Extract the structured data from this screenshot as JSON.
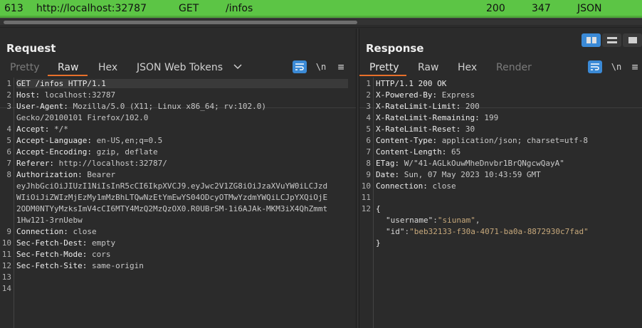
{
  "history": {
    "number": "613",
    "host": "http://localhost:32787",
    "method": "GET",
    "url": "/infos",
    "status": "200",
    "length": "347",
    "mime": "JSON"
  },
  "request": {
    "title": "Request",
    "tabs": [
      "Pretty",
      "Raw",
      "Hex",
      "JSON Web Tokens"
    ],
    "active_tab": "Raw",
    "line_numbers": [
      "1",
      "2",
      "3",
      "",
      "4",
      "5",
      "6",
      "7",
      "8",
      "",
      "",
      "",
      "",
      "9",
      "10",
      "11",
      "12",
      "13",
      "14"
    ],
    "lines": [
      {
        "k": "GET /infos HTTP/1.1",
        "v": ""
      },
      {
        "k": "Host:",
        "v": " localhost:32787"
      },
      {
        "k": "User-Agent:",
        "v": " Mozilla/5.0 (X11; Linux x86_64; rv:102.0)"
      },
      {
        "k": "",
        "v": "Gecko/20100101 Firefox/102.0"
      },
      {
        "k": "Accept:",
        "v": " */*"
      },
      {
        "k": "Accept-Language:",
        "v": " en-US,en;q=0.5"
      },
      {
        "k": "Accept-Encoding:",
        "v": " gzip, deflate"
      },
      {
        "k": "Referer:",
        "v": " http://localhost:32787/"
      },
      {
        "k": "Authorization:",
        "v": " Bearer"
      },
      {
        "k": "",
        "v": "eyJhbGciOiJIUzI1NiIsInR5cCI6IkpXVCJ9.eyJwc2V1ZG8iOiJzaXVuYW0iLCJzd"
      },
      {
        "k": "",
        "v": "WIiOiJiZWIzMjEzMy1mMzBhLTQwNzEtYmEwYS04ODcyOTMwYzdmYWQiLCJpYXQiOjE"
      },
      {
        "k": "",
        "v": "2ODM0NTYyMzksImV4cCI6MTY4MzQ2MzQzOX0.R0UBrSM-1i6AJAk-MKM3iX4QhZmmt"
      },
      {
        "k": "",
        "v": "1Hw121-3rnUebw"
      },
      {
        "k": "Connection:",
        "v": " close"
      },
      {
        "k": "Sec-Fetch-Dest:",
        "v": " empty"
      },
      {
        "k": "Sec-Fetch-Mode:",
        "v": " cors"
      },
      {
        "k": "Sec-Fetch-Site:",
        "v": " same-origin"
      },
      {
        "k": "",
        "v": ""
      },
      {
        "k": "",
        "v": ""
      }
    ]
  },
  "response": {
    "title": "Response",
    "tabs": [
      "Pretty",
      "Raw",
      "Hex",
      "Render"
    ],
    "active_tab": "Pretty",
    "line_numbers": [
      "1",
      "2",
      "3",
      "4",
      "5",
      "6",
      "7",
      "8",
      "9",
      "10",
      "11",
      "12",
      "",
      "",
      ""
    ],
    "lines": [
      {
        "k": "HTTP/1.1 200 OK",
        "v": ""
      },
      {
        "k": "X-Powered-By:",
        "v": " Express"
      },
      {
        "k": "X-RateLimit-Limit:",
        "v": " 200"
      },
      {
        "k": "X-RateLimit-Remaining:",
        "v": " 199"
      },
      {
        "k": "X-RateLimit-Reset:",
        "v": " 30"
      },
      {
        "k": "Content-Type:",
        "v": " application/json; charset=utf-8"
      },
      {
        "k": "Content-Length:",
        "v": " 65"
      },
      {
        "k": "ETag:",
        "v": " W/\"41-AGLkOuwMheDnvbr1BrQNgcwQayA\""
      },
      {
        "k": "Date:",
        "v": " Sun, 07 May 2023 10:43:59 GMT"
      },
      {
        "k": "Connection:",
        "v": " close"
      },
      {
        "k": "",
        "v": ""
      },
      {
        "k": "{",
        "v": ""
      },
      {
        "jk": "\"username\"",
        "jv": "\"siunam\"",
        "sep": ","
      },
      {
        "jk": "\"id\"",
        "jv": "\"beb32133-f30a-4071-ba0a-8872930c7fad\"",
        "sep": ""
      },
      {
        "k": "}",
        "v": ""
      }
    ]
  },
  "icons": {
    "wrap": "wrap-lines-icon",
    "newline": "show-newlines-icon",
    "menu": "hamburger-menu-icon",
    "chevron": "chevron-down-icon"
  },
  "icon_glyphs": {
    "newline": "\\n",
    "menu": "≡"
  },
  "colors": {
    "selected_row": "#5cc545",
    "accent": "#e8702a",
    "toggle_on": "#3b8ad6"
  }
}
